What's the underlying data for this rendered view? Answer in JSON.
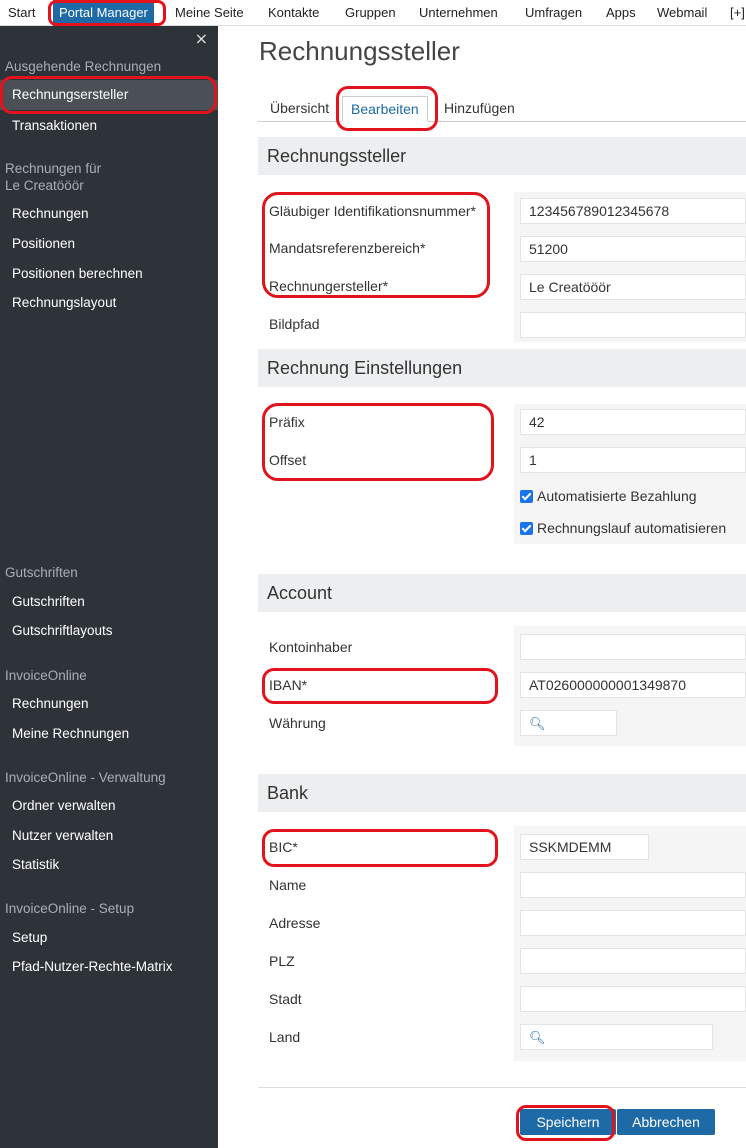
{
  "topnav": {
    "items": [
      "Start",
      "Portal Manager",
      "Meine Seite",
      "Kontakte",
      "Gruppen",
      "Unternehmen",
      "Umfragen",
      "Apps",
      "Webmail",
      "[+]"
    ]
  },
  "sidebar": {
    "close": "×",
    "sections": [
      {
        "title": "Ausgehende Rechnungen",
        "items": [
          "Rechnungsersteller",
          "Transaktionen"
        ]
      },
      {
        "title": "Rechnungen für",
        "subtitle": "Le Creatööör",
        "items": [
          "Rechnungen",
          "Positionen",
          "Positionen berechnen",
          "Rechnungslayout"
        ]
      },
      {
        "title": "Gutschriften",
        "items": [
          "Gutschriften",
          "Gutschriftlayouts"
        ]
      },
      {
        "title": "InvoiceOnline",
        "items": [
          "Rechnungen",
          "Meine Rechnungen"
        ]
      },
      {
        "title": "InvoiceOnline - Verwaltung",
        "items": [
          "Ordner verwalten",
          "Nutzer verwalten",
          "Statistik"
        ]
      },
      {
        "title": "InvoiceOnline - Setup",
        "items": [
          "Setup",
          "Pfad-Nutzer-Rechte-Matrix"
        ]
      }
    ]
  },
  "main": {
    "title": "Rechnungssteller",
    "tabs": [
      "Übersicht",
      "Bearbeiten",
      "Hinzufügen"
    ],
    "rechnungssteller": {
      "heading": "Rechnungssteller",
      "fields": [
        {
          "label": "Gläubiger Identifikationsnummer*",
          "value": "123456789012345678"
        },
        {
          "label": "Mandatsreferenzbereich*",
          "value": "51200"
        },
        {
          "label": "Rechnungersteller*",
          "value": "Le Creatööör"
        },
        {
          "label": "Bildpfad",
          "value": ""
        }
      ]
    },
    "einstellungen": {
      "heading": "Rechnung Einstellungen",
      "fields": [
        {
          "label": "Präfix",
          "value": "42"
        },
        {
          "label": "Offset",
          "value": "1"
        }
      ],
      "checkboxes": [
        "Automatisierte Bezahlung",
        "Rechnungslauf automatisieren"
      ]
    },
    "account": {
      "heading": "Account",
      "fields": [
        {
          "label": "Kontoinhaber",
          "value": ""
        },
        {
          "label": "IBAN*",
          "value": "AT026000000001349870"
        },
        {
          "label": "Währung",
          "value": ""
        }
      ]
    },
    "bank": {
      "heading": "Bank",
      "fields": [
        {
          "label": "BIC*",
          "value": "SSKMDEMM"
        },
        {
          "label": "Name",
          "value": ""
        },
        {
          "label": "Adresse",
          "value": ""
        },
        {
          "label": "PLZ",
          "value": ""
        },
        {
          "label": "Stadt",
          "value": ""
        },
        {
          "label": "Land",
          "value": ""
        }
      ]
    },
    "buttons": {
      "save": "Speichern",
      "cancel": "Abbrechen"
    }
  },
  "colors": {
    "accent": "#1d6aa6",
    "sidebar": "#2d3338",
    "highlight": "#e3131d"
  },
  "icons": {
    "close": "close-icon",
    "lookup": "magnifier-icon"
  }
}
